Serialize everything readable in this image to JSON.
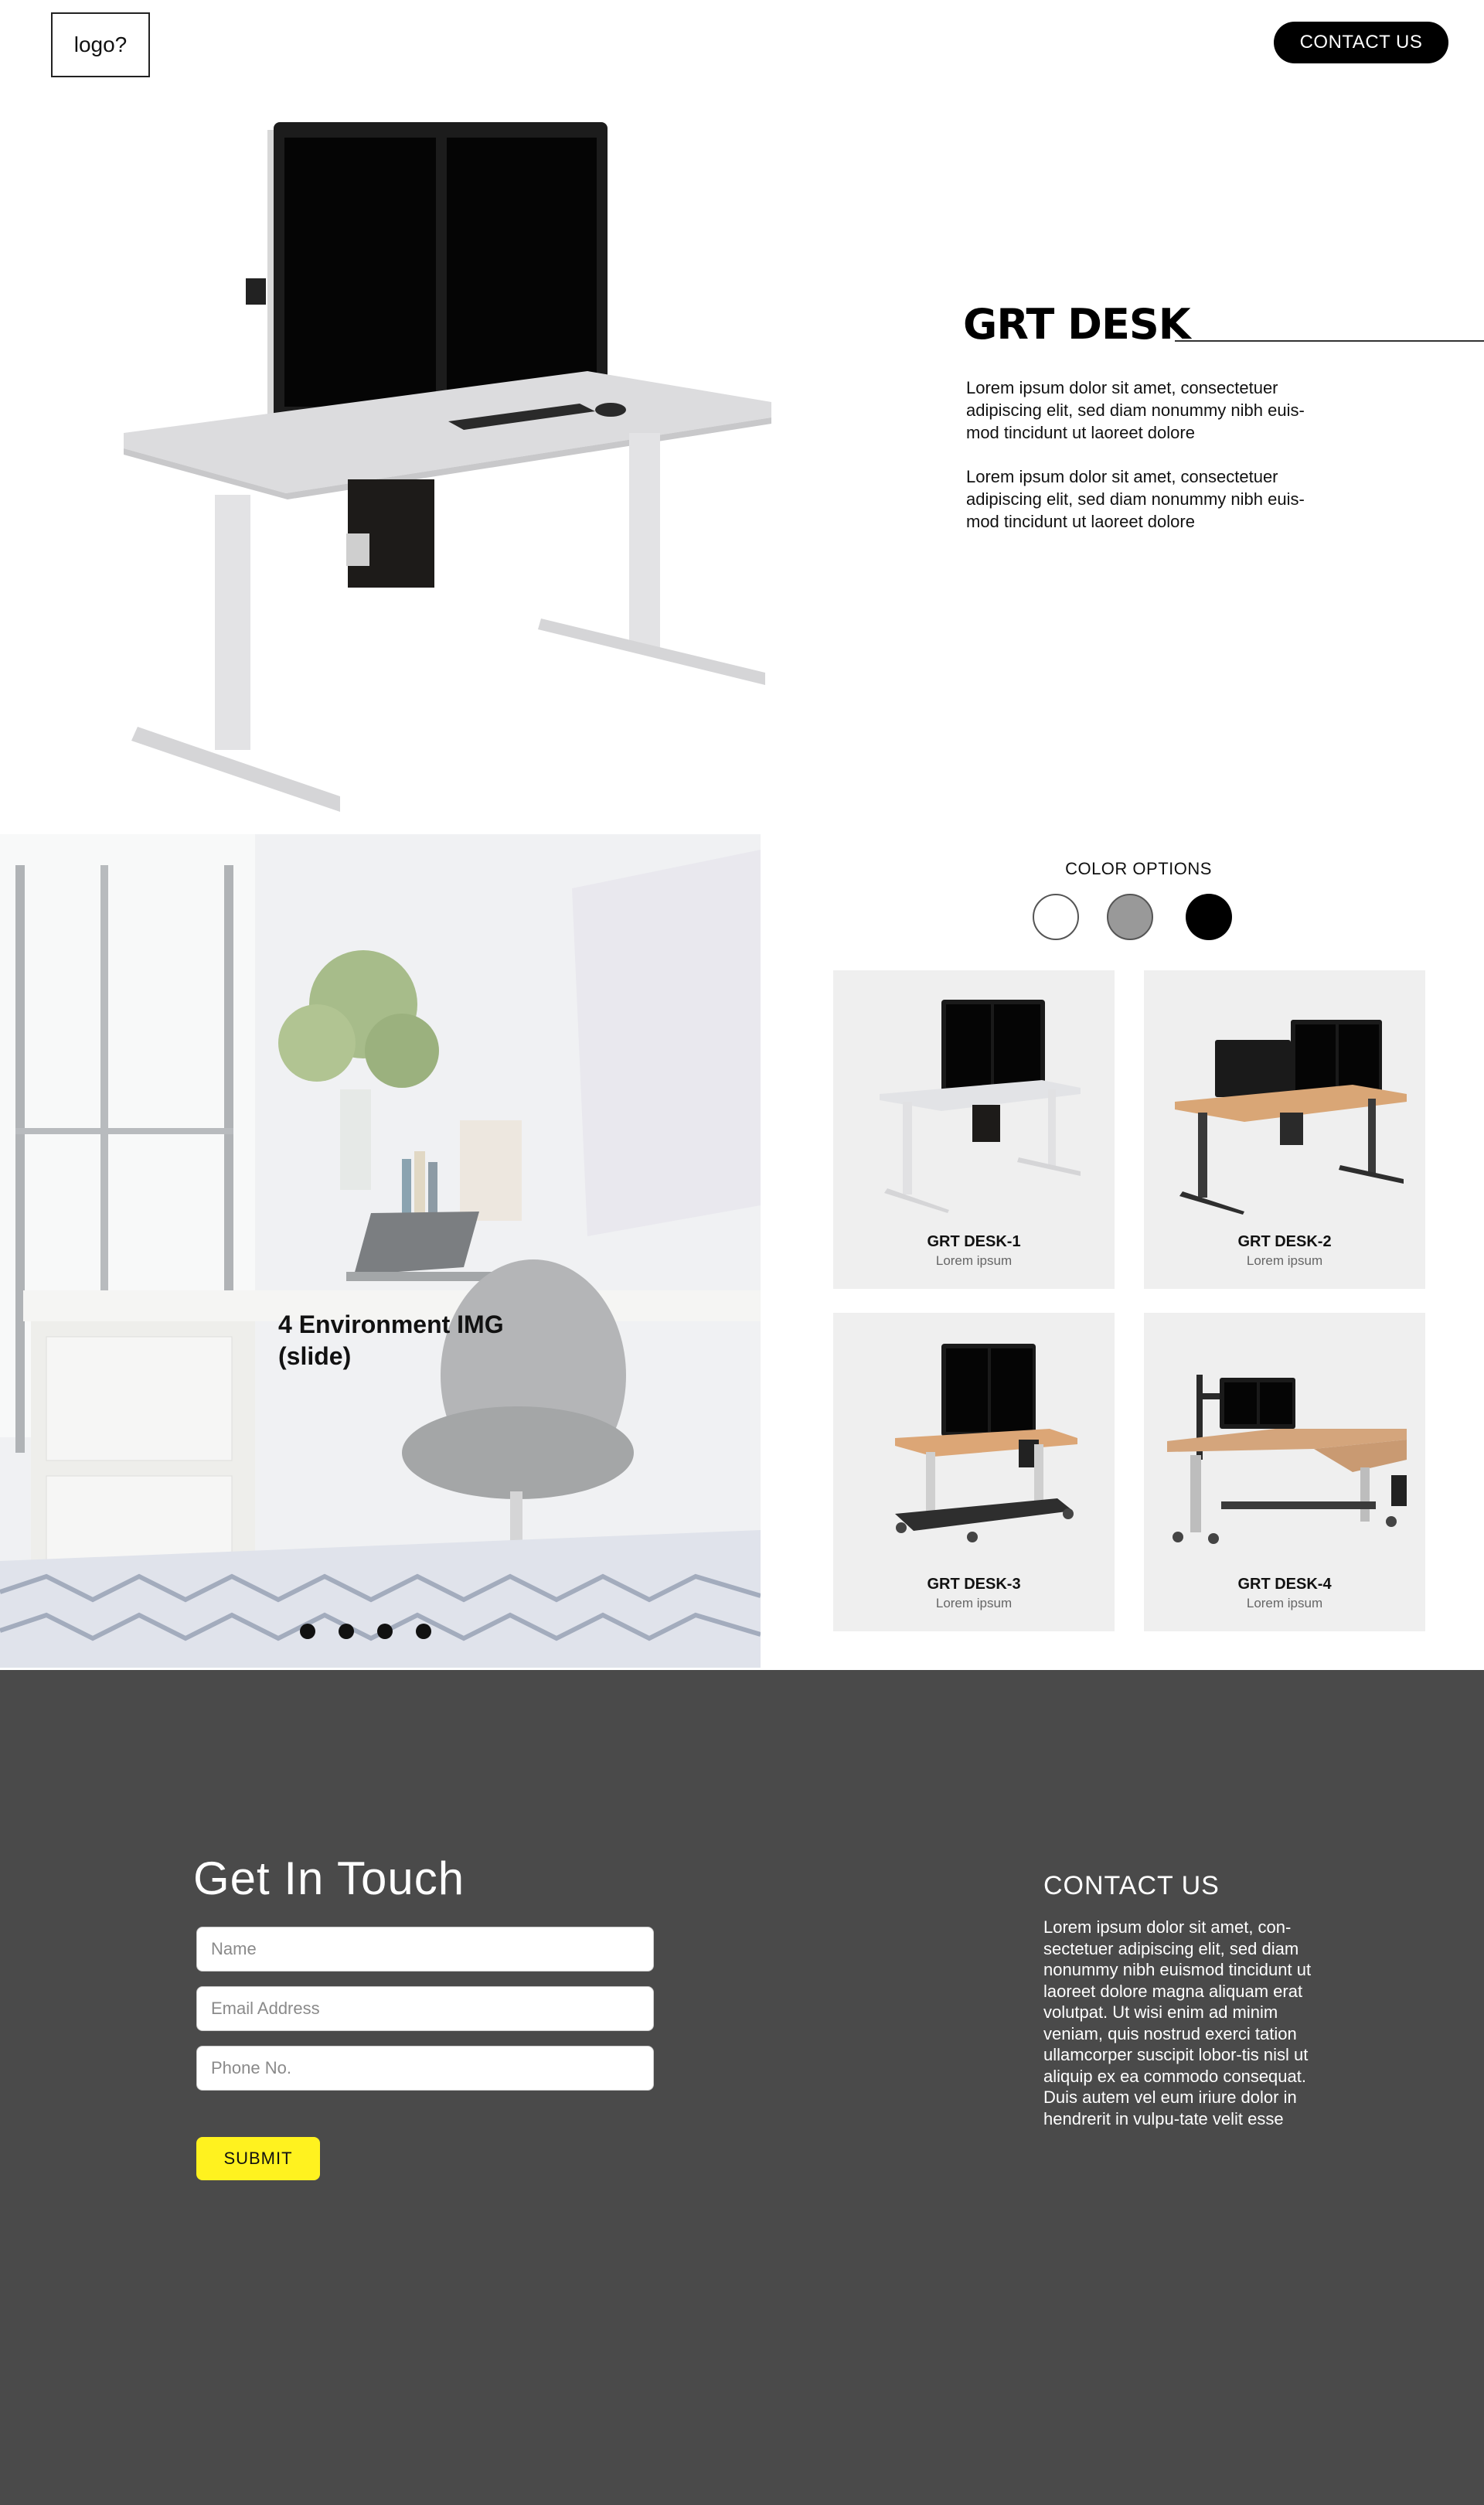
{
  "header": {
    "logo_text": "logo?",
    "contact_button": "CONTACT US"
  },
  "product": {
    "title": "GRT DESK",
    "description_1": "Lorem ipsum dolor sit amet, consectetuer adipiscing elit, sed diam nonummy nibh euis-mod tincidunt ut laoreet dolore",
    "description_2": "Lorem ipsum dolor sit amet, consectetuer adipiscing elit, sed diam nonummy nibh euis-mod tincidunt ut laoreet dolore"
  },
  "environment": {
    "caption": "4 Environment IMG (slide)",
    "slide_count": 4
  },
  "color_options": {
    "label": "COLOR OPTIONS",
    "swatches": [
      "#ffffff",
      "#999999",
      "#000000"
    ]
  },
  "products": [
    {
      "name": "GRT DESK-1",
      "subtitle": "Lorem ipsum"
    },
    {
      "name": "GRT DESK-2",
      "subtitle": "Lorem ipsum"
    },
    {
      "name": "GRT DESK-3",
      "subtitle": "Lorem ipsum"
    },
    {
      "name": "GRT DESK-4",
      "subtitle": "Lorem ipsum"
    }
  ],
  "contact_form": {
    "title": "Get In Touch",
    "name_placeholder": "Name",
    "email_placeholder": "Email Address",
    "phone_placeholder": "Phone No.",
    "submit_label": "SUBMIT"
  },
  "contact_info": {
    "title": "CONTACT US",
    "text": "Lorem ipsum dolor sit amet, con-sectetuer adipiscing elit, sed diam nonummy nibh euismod tincidunt ut laoreet dolore magna aliquam erat volutpat. Ut wisi enim ad minim veniam, quis nostrud exerci tation ullamcorper suscipit lobor-tis nisl ut aliquip ex ea commodo consequat. Duis autem vel eum iriure dolor in hendrerit in vulpu-tate velit esse"
  },
  "colors": {
    "footer_bg": "#4a4a4a",
    "submit_bg": "#fff21f",
    "card_bg": "#efefef"
  }
}
